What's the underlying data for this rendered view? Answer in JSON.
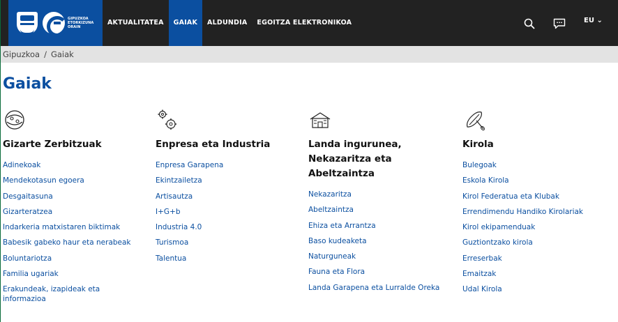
{
  "header": {
    "logo_text": [
      "GIPUZKOA",
      "ETORKIZUNA",
      "ORAIN"
    ],
    "nav": [
      "AKTUALITATEA",
      "GAIAK",
      "ALDUNDIA",
      "EGOITZA ELEKTRONIKOA"
    ],
    "active_nav": "GAIAK",
    "language": "EU"
  },
  "breadcrumb": {
    "home": "Gipuzkoa",
    "separator": "/",
    "current": "Gaiak"
  },
  "page": {
    "title": "Gaiak"
  },
  "categories": [
    {
      "icon": "people-circle-icon",
      "title": "Gizarte Zerbitzuak",
      "links": [
        "Adinekoak",
        "Mendekotasun egoera",
        "Desgaitasuna",
        "Gizarteratzea",
        "Indarkeria matxistaren biktimak",
        "Babesik gabeko haur eta nerabeak",
        "Boluntariotza",
        "Familia ugariak",
        "Erakundeak, izapideak eta informazioa"
      ]
    },
    {
      "icon": "gears-icon",
      "title": "Enpresa eta Industria",
      "links": [
        "Enpresa Garapena",
        "Ekintzailetza",
        "Artisautza",
        "I+G+b",
        "Industria 4.0",
        "Turismoa",
        "Talentua"
      ]
    },
    {
      "icon": "farmhouse-icon",
      "title": "Landa ingurunea, Nekazaritza eta Abeltzaintza",
      "links": [
        "Nekazaritza",
        "Abeltzaintza",
        "Ehiza eta Arrantza",
        "Baso kudeaketa",
        "Naturguneak",
        "Fauna eta Flora",
        "Landa Garapena eta Lurralde Oreka"
      ]
    },
    {
      "icon": "canoe-paddle-icon",
      "title": "Kirola",
      "links": [
        "Bulegoak",
        "Eskola Kirola",
        "Kirol Federatua eta Klubak",
        "Errendimendu Handiko Kirolariak",
        "Kirol ekipamenduak",
        "Guztiontzako kirola",
        "Erreserbak",
        "Emaitzak",
        "Udal Kirola"
      ]
    }
  ]
}
